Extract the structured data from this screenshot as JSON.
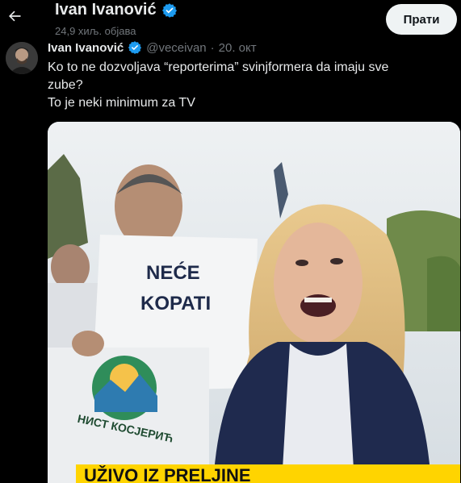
{
  "header": {
    "title": "Ivan Ivanović",
    "subtitle": "24,9 хиљ. објава",
    "follow_label": "Прати"
  },
  "tweet": {
    "author_name": "Ivan Ivanović",
    "handle": "@veceivan",
    "dot": "·",
    "date": "20. окт",
    "text_lines": [
      "Ko to ne dozvoljava “reporterima” svinjformera da imaju sve",
      "zube?",
      "To je neki minimum za TV"
    ]
  },
  "media": {
    "sign_line1": "NEĆE",
    "sign_line2": "KOPATI",
    "logo_text": "НИСТ КОСЈЕРИЋ",
    "banner_text": "UŽIVO IZ PRELJINE"
  },
  "icons": {
    "back": "arrow-left-icon",
    "verified": "verified-badge-icon"
  },
  "colors": {
    "background": "#000000",
    "verified": "#1d9bf0",
    "follow_bg": "#eff3f4",
    "banner": "#ffd400"
  }
}
